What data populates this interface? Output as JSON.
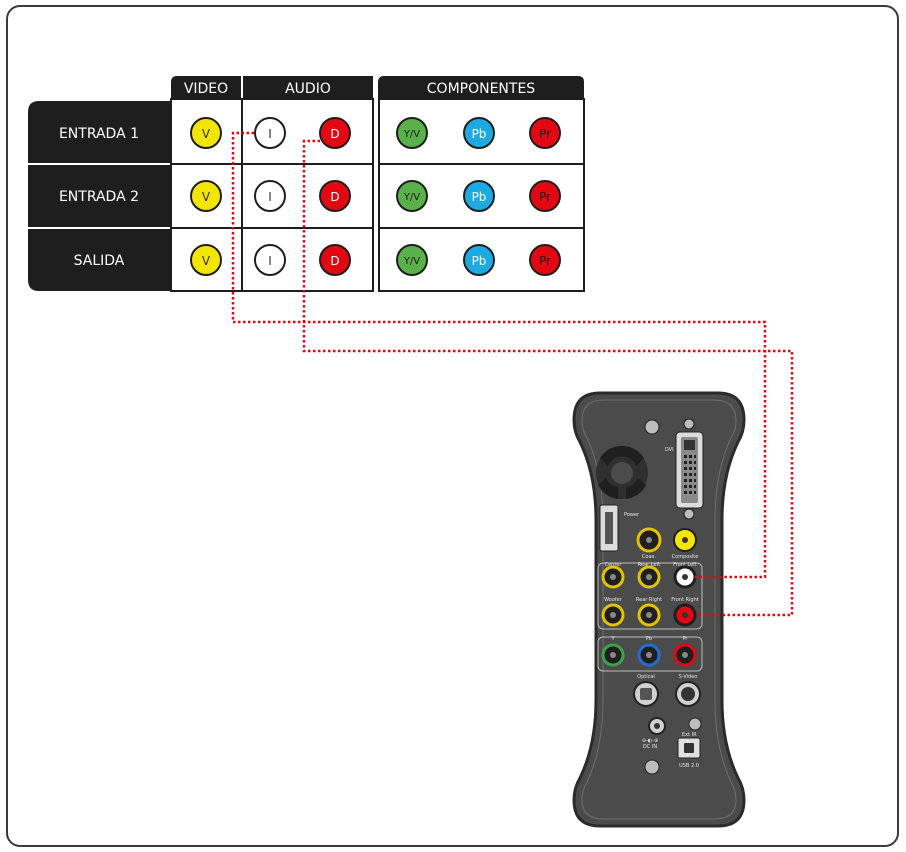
{
  "headers": {
    "video": "VIDEO",
    "audio": "AUDIO",
    "components": "COMPONENTES"
  },
  "rows": [
    {
      "label": "ENTRADA 1",
      "cells": [
        "V",
        "I",
        "D",
        "Y/V",
        "Pb",
        "Pr"
      ]
    },
    {
      "label": "ENTRADA 2",
      "cells": [
        "V",
        "I",
        "D",
        "Y/V",
        "Pb",
        "Pr"
      ]
    },
    {
      "label": "SALIDA",
      "cells": [
        "V",
        "I",
        "D",
        "Y/V",
        "Pb",
        "Pr"
      ]
    }
  ],
  "colors": {
    "video": "#f2e600",
    "audio_left": "#ffffff",
    "audio_right": "#e30613",
    "y": "#5ab04a",
    "pb": "#1fa9e1",
    "pr": "#e30613",
    "table_dark": "#1e1e1e",
    "cable": "#e30613",
    "device_body": "#4a4a4a"
  },
  "device": {
    "labels": {
      "dvi": "DVI",
      "power": "Power",
      "coax": "Coax.",
      "composite": "Composite",
      "center": "Center",
      "rear_left": "Rear Left",
      "front_left": "Front Left",
      "woofer": "Woofer",
      "rear_right": "Rear Right",
      "front_right": "Front Right",
      "y": "Y",
      "pb": "Pb",
      "pr": "Pr",
      "optical": "Optical",
      "svideo": "S-Video",
      "ext_ir": "Ext IR",
      "dc_in": "DC IN",
      "usb": "USB 2.0"
    }
  }
}
